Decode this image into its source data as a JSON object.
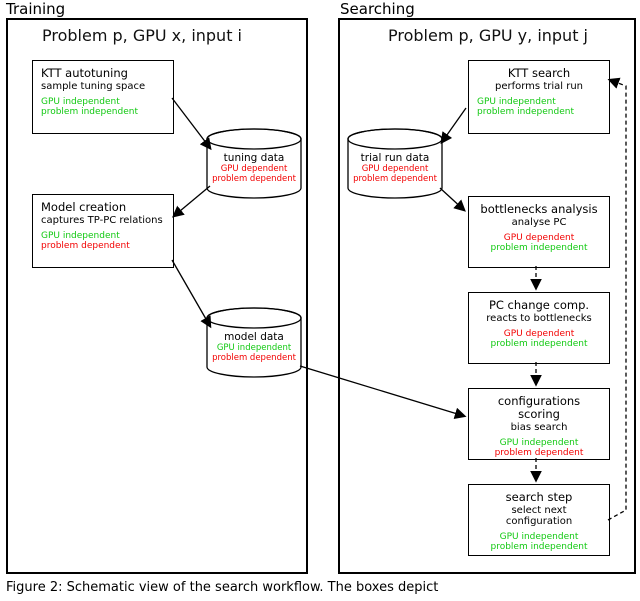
{
  "training": {
    "label": "Training",
    "title": "Problem p, GPU x, input i",
    "ktt": {
      "title": "KTT autotuning",
      "sub": "sample tuning space",
      "gpu": "GPU independent",
      "prob": "problem independent"
    },
    "model": {
      "title": "Model creation",
      "sub": "captures TP-PC relations",
      "gpu": "GPU independent",
      "prob": "problem dependent"
    },
    "tuning_cyl": {
      "title": "tuning data",
      "gpu": "GPU dependent",
      "prob": "problem dependent"
    },
    "model_cyl": {
      "title": "model data",
      "gpu": "GPU independent",
      "prob": "problem dependent"
    }
  },
  "searching": {
    "label": "Searching",
    "title": "Problem p, GPU y, input j",
    "trial_cyl": {
      "title": "trial run data",
      "gpu": "GPU dependent",
      "prob": "problem dependent"
    },
    "ktt": {
      "title": "KTT search",
      "sub": "performs trial run",
      "gpu": "GPU independent",
      "prob": "problem independent"
    },
    "bottlenecks": {
      "title": "bottlenecks analysis",
      "sub": "analyse PC",
      "gpu": "GPU dependent",
      "prob": "problem independent"
    },
    "pcchange": {
      "title": "PC change comp.",
      "sub": "reacts to bottlenecks",
      "gpu": "GPU dependent",
      "prob": "problem independent"
    },
    "configscore": {
      "title": "configurations scoring",
      "sub": "bias search",
      "gpu": "GPU  independent",
      "prob": "problem dependent"
    },
    "searchstep": {
      "title": "search step",
      "sub": "select next configuration",
      "gpu": "GPU independent",
      "prob": "problem independent"
    }
  },
  "caption": "Figure 2: Schematic view of the search workflow. The boxes depict"
}
